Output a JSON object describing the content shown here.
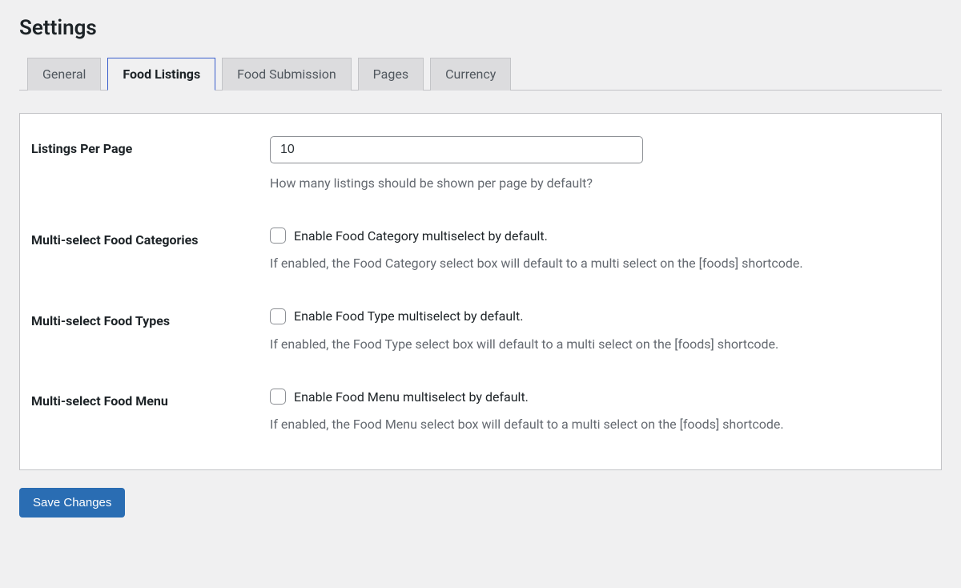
{
  "page_title": "Settings",
  "tabs": [
    {
      "label": "General",
      "active": false
    },
    {
      "label": "Food Listings",
      "active": true
    },
    {
      "label": "Food Submission",
      "active": false
    },
    {
      "label": "Pages",
      "active": false
    },
    {
      "label": "Currency",
      "active": false
    }
  ],
  "fields": {
    "listings_per_page": {
      "label": "Listings Per Page",
      "value": "10",
      "help": "How many listings should be shown per page by default?"
    },
    "multi_categories": {
      "label": "Multi-select Food Categories",
      "checkbox_label": "Enable Food Category multiselect by default.",
      "help": "If enabled, the Food Category select box will default to a multi select on the [foods] shortcode.",
      "checked": false
    },
    "multi_types": {
      "label": "Multi-select Food Types",
      "checkbox_label": "Enable Food Type multiselect by default.",
      "help": "If enabled, the Food Type select box will default to a multi select on the [foods] shortcode.",
      "checked": false
    },
    "multi_menu": {
      "label": "Multi-select Food Menu",
      "checkbox_label": "Enable Food Menu multiselect by default.",
      "help": "If enabled, the Food Menu select box will default to a multi select on the [foods] shortcode.",
      "checked": false
    }
  },
  "save_button": "Save Changes"
}
